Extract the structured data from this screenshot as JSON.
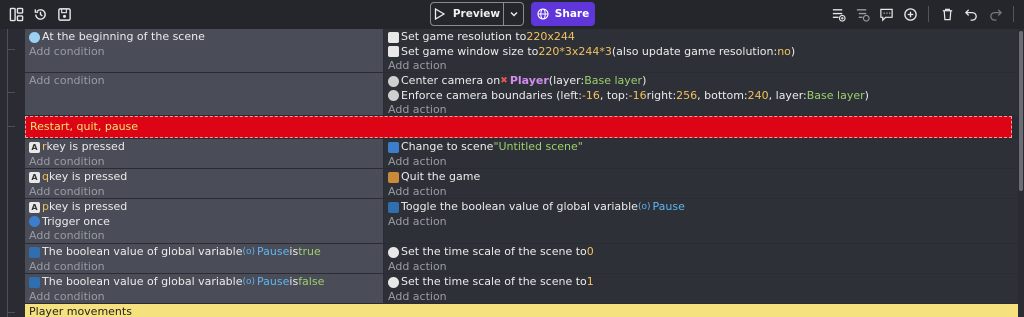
{
  "toolbar": {
    "left_icons": [
      "layout-icon",
      "history-icon",
      "save-icon"
    ],
    "preview_label": "Preview",
    "share_label": "Share",
    "right_icons": [
      "add-event-icon",
      "add-subevent-icon",
      "add-comment-icon",
      "add-icon",
      "delete-icon",
      "undo-icon",
      "redo-icon",
      "search-icon"
    ],
    "colors": {
      "share": "#5e36d9"
    }
  },
  "events": [
    {
      "conditions": [
        "At the beginning of the scene"
      ],
      "add_condition": "Add condition",
      "actions": [
        {
          "text": "Set game resolution to ",
          "value": "220x244"
        },
        {
          "text": "Set game window size to ",
          "value": "220*3x244*3",
          "suffix": " (also update game resolution: ",
          "flag": "no",
          "end": ")"
        }
      ],
      "add_action": "Add action"
    },
    {
      "conditions": [],
      "add_condition": "Add condition",
      "actions": [
        {
          "text": "Center camera on ",
          "object": "Player",
          "rest": " (layer: ",
          "layer": "Base layer",
          "end": ")"
        },
        {
          "text": "Enforce camera boundaries (left: ",
          "left": "-16",
          "t2": ", top: ",
          "top": "-16",
          "t3": " right: ",
          "right": "256",
          "t4": ", bottom: ",
          "bottom": "240",
          "t5": ", layer: ",
          "layer": "Base layer",
          "end": ")"
        }
      ],
      "add_action": "Add action"
    }
  ],
  "comments": {
    "red": "Restart, quit, pause",
    "yellow": "Player movements"
  },
  "key_events": [
    {
      "key": "r",
      "cond_suffix": " key is pressed",
      "action": "Change to scene ",
      "action_value": "\"Untitled scene\""
    },
    {
      "key": "q",
      "cond_suffix": " key is pressed",
      "action": "Quit the game",
      "action_value": ""
    },
    {
      "key": "p",
      "cond_suffix": " key is pressed",
      "trigger": "Trigger once",
      "action": "Toggle the boolean value of global variable ",
      "action_value": "Pause"
    }
  ],
  "pause_events": [
    {
      "cond_prefix": "The boolean value of global variable ",
      "var": "Pause",
      "is": " is ",
      "bool": "true",
      "action": "Set the time scale of the scene to ",
      "scale": "0"
    },
    {
      "cond_prefix": "The boolean value of global variable ",
      "var": "Pause",
      "is": " is ",
      "bool": "false",
      "action": "Set the time scale of the scene to ",
      "scale": "1"
    }
  ],
  "labels": {
    "add_condition": "Add condition",
    "add_action": "Add action"
  }
}
